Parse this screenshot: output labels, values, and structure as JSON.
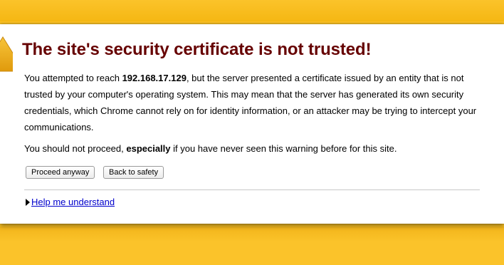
{
  "title": "The site's security certificate is not trusted!",
  "paragraph1": {
    "before": "You attempted to reach ",
    "host": "192.168.17.129",
    "after": ", but the server presented a certificate issued by an entity that is not trusted by your computer's operating system. This may mean that the server has generated its own security credentials, which Chrome cannot rely on for identity information, or an attacker may be trying to intercept your communications."
  },
  "paragraph2": {
    "before": "You should not proceed, ",
    "emphasis": "especially",
    "after": " if you have never seen this warning before for this site."
  },
  "buttons": {
    "proceed": "Proceed anyway",
    "back": "Back to safety"
  },
  "help": {
    "link": "Help me understand"
  },
  "icons": {
    "warning": "warning-triangle-icon",
    "expand": "disclosure-triangle-icon"
  },
  "colors": {
    "background": "#fcc324",
    "title": "#660000",
    "link": "#0000cc"
  }
}
